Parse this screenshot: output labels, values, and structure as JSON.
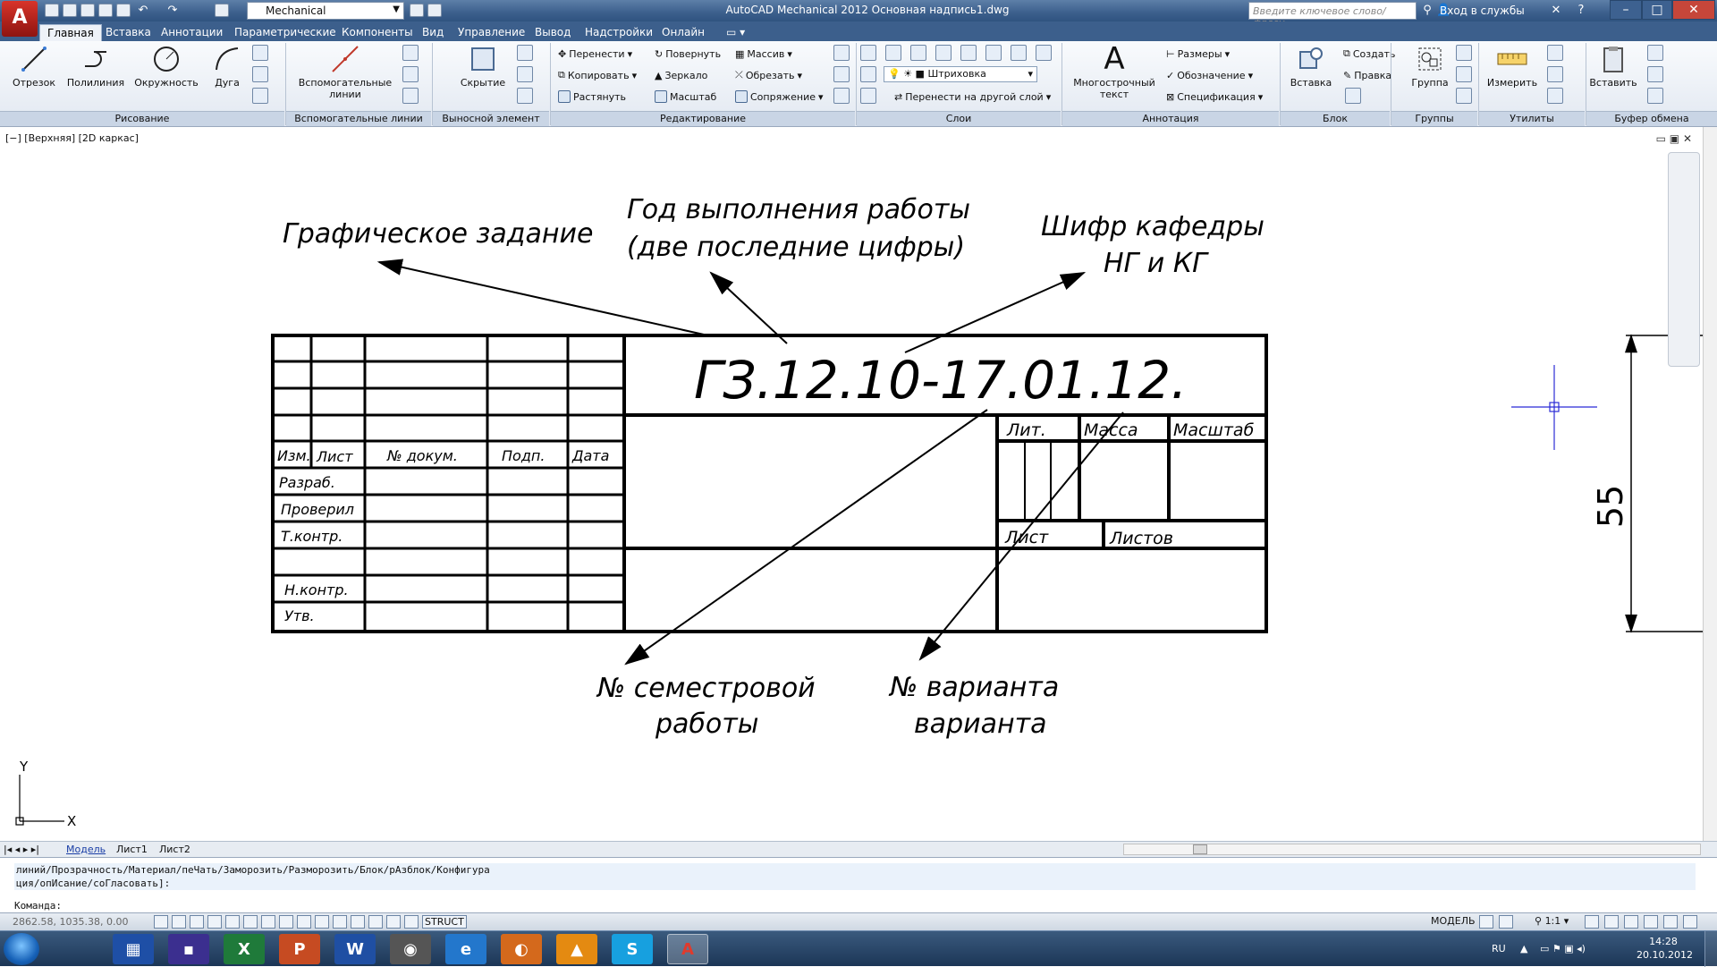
{
  "app": {
    "workspace": "Mechanical",
    "window_title": "AutoCAD Mechanical 2012    Основная надпись1.dwg",
    "search_placeholder": "Введите ключевое слово/фразу",
    "signin": "Вход в службы"
  },
  "ribbon_tabs": [
    "Главная",
    "Вставка",
    "Аннотации",
    "Параметрические",
    "Компоненты",
    "Вид",
    "Управление",
    "Вывод",
    "Надстройки",
    "Онлайн"
  ],
  "ribbon": {
    "draw": {
      "title": "Рисование",
      "line": "Отрезок",
      "polyline": "Полилиния",
      "circle": "Окружность",
      "arc": "Дуга"
    },
    "construction": {
      "title": "Вспомогательные линии",
      "button": "Вспомогательные линии"
    },
    "detail": {
      "title": "Выносной элемент",
      "hidden": "Скрытие"
    },
    "modify": {
      "title": "Редактирование",
      "move": "Перенести",
      "rotate": "Повернуть",
      "array": "Массив",
      "copy": "Копировать",
      "mirror": "Зеркало",
      "trim": "Обрезать",
      "stretch": "Растянуть",
      "scale": "Масштаб",
      "fillet": "Сопряжение"
    },
    "layers": {
      "title": "Слои",
      "hatch": "Штриховка",
      "move_layer": "Перенести на другой слой"
    },
    "annotation": {
      "title": "Аннотация",
      "mtext": "Многострочный текст",
      "dims": "Размеры",
      "symbols": "Обозначение",
      "spec": "Спецификация"
    },
    "block": {
      "title": "Блок",
      "insert": "Вставка",
      "create": "Создать",
      "edit": "Правка"
    },
    "groups": {
      "title": "Группы",
      "group": "Группа"
    },
    "utilities": {
      "title": "Утилиты",
      "measure": "Измерить"
    },
    "clipboard": {
      "title": "Буфер обмена",
      "paste": "Вставить"
    }
  },
  "viewport": {
    "label": "[−] [Верхняя] [2D каркас]"
  },
  "drawing": {
    "designation": "ГЗ.12.10-17.01.12.",
    "dimension": "55",
    "callouts": {
      "task": "Графическое задание",
      "year_1": "Год выполнения работы",
      "year_2": "(две последние цифры)",
      "code_1": "Шифр кафедры",
      "code_2": "НГ и КГ",
      "semester_1": "№ семестровой",
      "semester_2": "работы",
      "variant_1": "№ варианта",
      "variant_2": "варианта"
    },
    "table": {
      "izm": "Изм.",
      "list": "Лист",
      "doc": "№ докум.",
      "sign": "Подп.",
      "date": "Дата",
      "razrab": "Разраб.",
      "proveril": "Проверил",
      "tkontr": "Т.контр.",
      "nkontr": "Н.контр.",
      "utv": "Утв.",
      "lit": "Лит.",
      "mass": "Масса",
      "scale": "Масштаб",
      "sheet": "Лист",
      "sheets": "Листов"
    },
    "ucs": {
      "x": "X",
      "y": "Y"
    }
  },
  "layout_tabs": [
    "Модель",
    "Лист1",
    "Лист2"
  ],
  "command": {
    "line1": "линий/Прозрачность/Материал/пеЧать/Заморозить/Разморозить/Блок/рАзблок/Конфигура",
    "line2": "ция/опИсание/соГласовать]:",
    "prompt": "Команда:"
  },
  "status": {
    "coords": "2862.58, 1035.38, 0.00",
    "struct": "STRUCT",
    "model": "МОДЕЛЬ",
    "scale": "1:1"
  },
  "taskbar": {
    "lang": "RU",
    "time": "14:28",
    "date": "20.10.2012"
  }
}
